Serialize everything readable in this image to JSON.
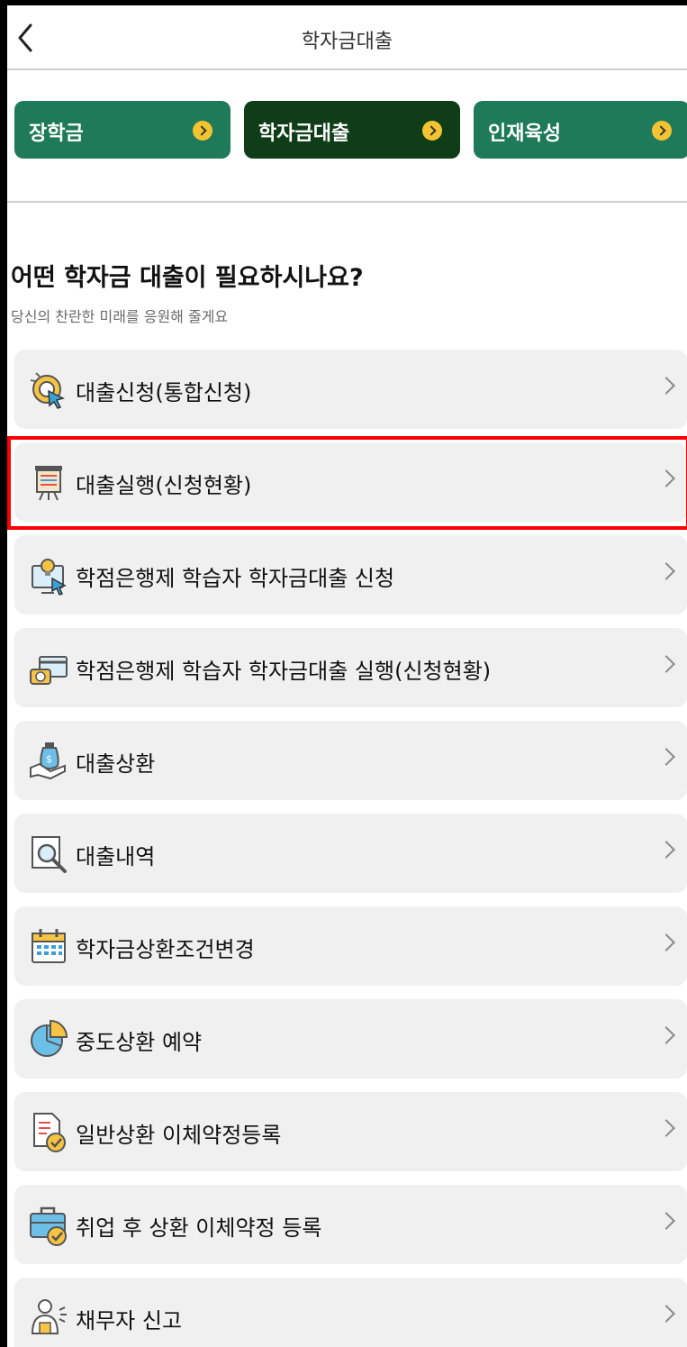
{
  "header": {
    "title": "학자금대출"
  },
  "tabs": [
    {
      "label": "장학금",
      "active": false
    },
    {
      "label": "학자금대출",
      "active": true
    },
    {
      "label": "인재육성",
      "active": false
    }
  ],
  "section": {
    "title": "어떤 학자금 대출이 필요하시나요?",
    "subtitle": "당신의 찬란한 미래를 응원해 줄게요"
  },
  "menu": [
    {
      "label": "대출신청(통합신청)",
      "icon": "cursor-target-icon"
    },
    {
      "label": "대출실행(신청현황)",
      "icon": "presentation-board-icon"
    },
    {
      "label": "학점은행제 학습자 학자금대출 신청",
      "icon": "lightbulb-monitor-icon"
    },
    {
      "label": "학점은행제 학습자 학자금대출 실행(신청현황)",
      "icon": "money-card-icon"
    },
    {
      "label": "대출상환",
      "icon": "hand-money-bag-icon"
    },
    {
      "label": "대출내역",
      "icon": "document-magnifier-icon"
    },
    {
      "label": "학자금상환조건변경",
      "icon": "calendar-icon"
    },
    {
      "label": "중도상환 예약",
      "icon": "pie-chart-icon"
    },
    {
      "label": "일반상환 이체약정등록",
      "icon": "checklist-document-icon"
    },
    {
      "label": "취업 후 상환 이체약정 등록",
      "icon": "briefcase-check-icon"
    },
    {
      "label": "채무자 신고",
      "icon": "person-report-icon"
    }
  ],
  "colors": {
    "tab": "#1f7a5a",
    "tab_active": "#0f3d17",
    "arrow_badge": "#f4c430",
    "highlight": "#ff0000"
  }
}
